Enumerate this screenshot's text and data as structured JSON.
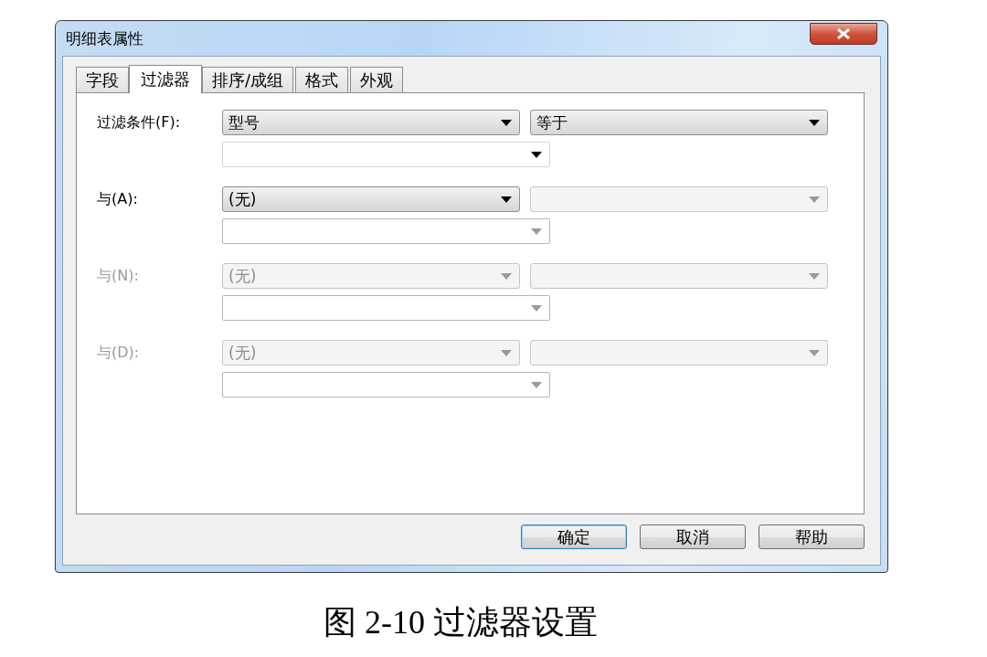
{
  "window": {
    "title": "明细表属性"
  },
  "tabs": [
    {
      "label": "字段",
      "selected": false
    },
    {
      "label": "过滤器",
      "selected": true
    },
    {
      "label": "排序/成组",
      "selected": false
    },
    {
      "label": "格式",
      "selected": false
    },
    {
      "label": "外观",
      "selected": false
    }
  ],
  "filters": [
    {
      "label": "过滤条件(F):",
      "disabled": false,
      "field": {
        "value": "型号",
        "disabled": false
      },
      "operator": {
        "value": "等于",
        "disabled": false
      },
      "value": {
        "disabled": false
      }
    },
    {
      "label": "与(A):",
      "disabled": false,
      "field": {
        "value": "(无)",
        "disabled": false
      },
      "operator": {
        "disabled": true
      },
      "value": {
        "disabled": true
      }
    },
    {
      "label": "与(N):",
      "disabled": true,
      "field": {
        "value": "(无)",
        "disabled": true
      },
      "operator": {
        "disabled": true
      },
      "value": {
        "disabled": true
      }
    },
    {
      "label": "与(D):",
      "disabled": true,
      "field": {
        "value": "(无)",
        "disabled": true
      },
      "operator": {
        "disabled": true
      },
      "value": {
        "disabled": true
      }
    }
  ],
  "buttons": [
    {
      "label": "确定",
      "default": true
    },
    {
      "label": "取消",
      "default": false
    },
    {
      "label": "帮助",
      "default": false
    }
  ],
  "caption": "图 2-10 过滤器设置"
}
